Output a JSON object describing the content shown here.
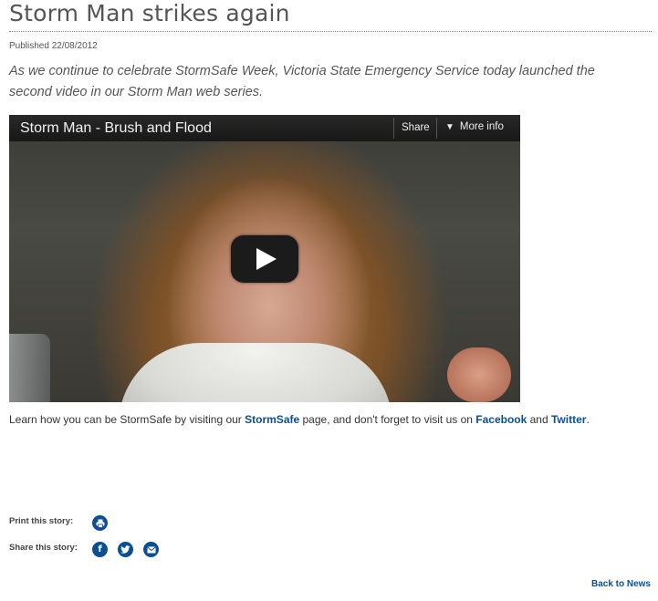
{
  "article": {
    "title": "Storm Man strikes again",
    "published": "Published 22/08/2012",
    "lead": "As we continue to celebrate StormSafe Week, Victoria State Emergency Service today launched the second video in our Storm Man web series."
  },
  "video": {
    "title": "Storm Man - Brush and Flood",
    "share_label": "Share",
    "more_info_label": "More info"
  },
  "learn": {
    "text_1": "Learn how you can be StormSafe by visiting our ",
    "stormsafe_link": "StormSafe",
    "text_2": " page, and don't forget to visit us on ",
    "facebook_link": "Facebook",
    "text_3": " and ",
    "twitter_link": "Twitter",
    "text_4": "."
  },
  "sharing": {
    "print_label": "Print this story:",
    "share_label": "Share this story:"
  },
  "icons": {
    "print": "print-icon",
    "facebook": "facebook-icon",
    "twitter": "twitter-icon",
    "email": "email-icon"
  },
  "colors": {
    "link": "#0b4f92"
  },
  "footer": {
    "back_label": "Back to News"
  }
}
